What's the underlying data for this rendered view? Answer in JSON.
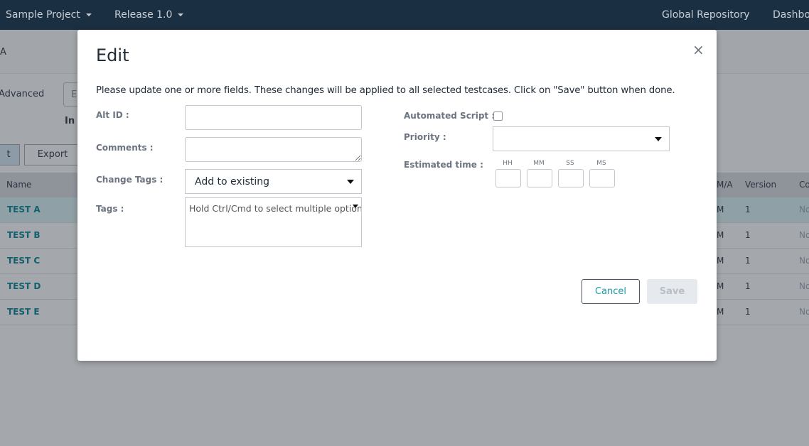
{
  "topbar": {
    "project": "Sample Project",
    "release": "Release 1.0",
    "global_repo": "Global Repository",
    "dashboard": "Dashbo"
  },
  "background": {
    "crumb": "A",
    "advanced": "Advanced",
    "search_partial": "E",
    "in_partial": "In t",
    "btn_partial": "t",
    "export": "Export",
    "columns": {
      "name": "Name",
      "ma": "M/A",
      "version": "Version",
      "co": "Co"
    },
    "rows": [
      {
        "name": "TEST A",
        "ma": "M",
        "version": "1",
        "co": "No"
      },
      {
        "name": "TEST B",
        "ma": "M",
        "version": "1",
        "co": "No"
      },
      {
        "name": "TEST C",
        "ma": "M",
        "version": "1",
        "co": "No"
      },
      {
        "name": "TEST D",
        "ma": "M",
        "version": "1",
        "co": "No"
      },
      {
        "name": "TEST E",
        "ma": "M",
        "version": "1",
        "co": "No"
      }
    ]
  },
  "modal": {
    "title": "Edit",
    "close": "×",
    "instructions": "Please update one or more fields. These changes will be applied to all selected testcases. Click on \"Save\" button when done.",
    "alt_id_label": "Alt ID :",
    "alt_id_value": "",
    "comments_label": "Comments :",
    "comments_value": "",
    "change_tags_label": "Change Tags :",
    "change_tags_value": "Add to existing",
    "tags_label": "Tags :",
    "tags_placeholder": "Hold Ctrl/Cmd to select multiple option",
    "automated_label": "Automated Script :",
    "automated_checked": false,
    "priority_label": "Priority :",
    "priority_value": "",
    "est_label": "Estimated time :",
    "time_units": [
      "HH",
      "MM",
      "SS",
      "MS"
    ],
    "cancel": "Cancel",
    "save": "Save"
  },
  "colors": {
    "accent": "#1a9ba8",
    "navbar": "#1b2f42"
  }
}
